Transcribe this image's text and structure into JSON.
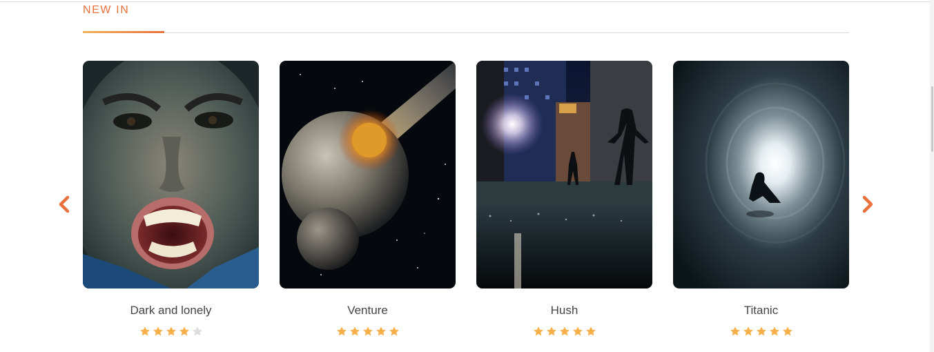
{
  "section": {
    "title": "NEW IN"
  },
  "colors": {
    "accent": "#e8703a",
    "accent_light": "#f2b25a",
    "star_filled": "#f6b04a",
    "star_empty": "#dcdcdc"
  },
  "carousel": {
    "prev_icon": "chevron-left-icon",
    "next_icon": "chevron-right-icon",
    "items": [
      {
        "title": "Dark and lonely",
        "rating": 4,
        "max_rating": 5,
        "image": "screaming-child-poster"
      },
      {
        "title": "Venture",
        "rating": 5,
        "max_rating": 5,
        "image": "planet-impact-poster"
      },
      {
        "title": "Hush",
        "rating": 5,
        "max_rating": 5,
        "image": "night-alley-poster"
      },
      {
        "title": "Titanic",
        "rating": 5,
        "max_rating": 5,
        "image": "light-tunnel-poster"
      }
    ]
  }
}
